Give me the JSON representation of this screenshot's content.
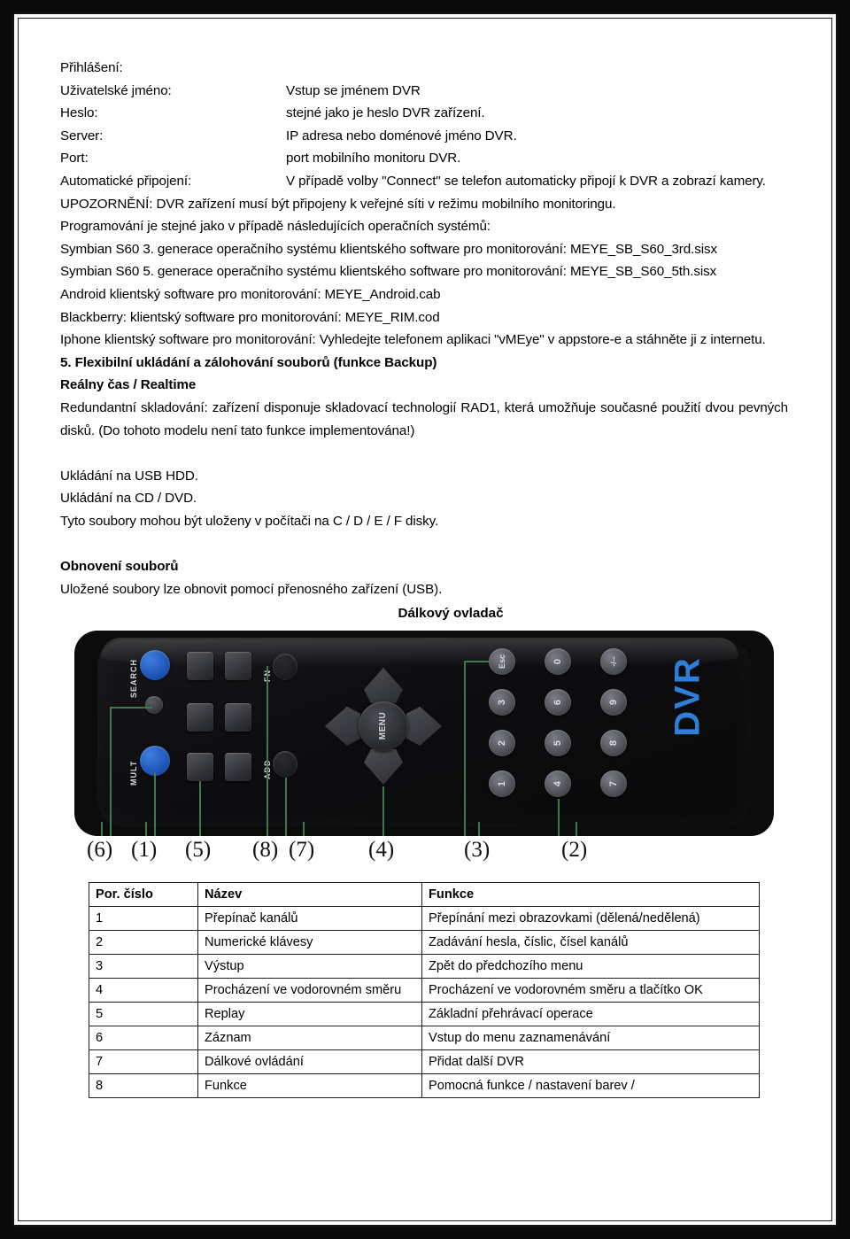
{
  "document": {
    "login_section": {
      "title": "Přihlášení:",
      "fields": [
        {
          "label": "Uživatelské jméno:",
          "value": "Vstup se jménem DVR"
        },
        {
          "label": "Heslo:",
          "value": "stejné jako je heslo DVR zařízení."
        },
        {
          "label": "Server:",
          "value": "IP adresa nebo doménové jméno DVR."
        },
        {
          "label": "Port:",
          "value": "port mobilního monitoru DVR."
        },
        {
          "label": "Automatické připojení:",
          "value": "V případě volby \"Connect\" se telefon automaticky připojí k DVR a zobrazí kamery."
        }
      ]
    },
    "notice": "UPOZORNĚNÍ: DVR zařízení musí být připojeny k veřejné síti v režimu mobilního monitoringu.",
    "programming_intro": "Programování je stejné jako v případě následujících operačních systémů:",
    "platforms": [
      "Symbian S60 3. generace operačního systému klientského software pro monitorování: MEYE_SB_S60_3rd.sisx",
      "Symbian S60 5. generace operačního systému klientského software pro monitorování: MEYE_SB_S60_5th.sisx",
      "Android klientský software pro monitorování: MEYE_Android.cab",
      "Blackberry: klientský software pro monitorování: MEYE_RIM.cod",
      "Iphone klientský software pro monitorování: Vyhledejte telefonem aplikaci \"vMEye\" v appstore-e a stáhněte ji z internetu."
    ],
    "section5": {
      "heading": "5. Flexibilní ukládání a zálohování souborů (funkce Backup)",
      "subheading": "Reálny čas / Realtime",
      "body": "Redundantní skladování: zařízení disponuje skladovací technologií RAD1, která umožňuje současné použití dvou pevných disků. (Do tohoto modelu není tato funkce implementována!)",
      "storage_lines": [
        "Ukládání na USB HDD.",
        "Ukládání na CD / DVD.",
        "Tyto soubory mohou být uloženy v počítači na C / D / E / F disky."
      ]
    },
    "restore": {
      "heading": "Obnovení souborů",
      "body": "Uložené soubory lze obnovit pomocí přenosného zařízení (USB)."
    },
    "figure": {
      "caption": "Dálkový ovladač",
      "labels": {
        "search": "SEARCH",
        "mult": "MULT",
        "fn": "FN",
        "add": "ADD",
        "menu": "MENU",
        "esc": "Esc",
        "brand": "DVR"
      },
      "keypad_keys": [
        "Esc",
        "0",
        "-/--",
        "3",
        "6",
        "9",
        "2",
        "5",
        "8",
        "1",
        "4",
        "7"
      ],
      "callouts": [
        "(6)",
        "(1)",
        "(5)",
        "(8)",
        "(7)",
        "(4)",
        "(3)",
        "(2)"
      ]
    },
    "table": {
      "headers": [
        "Por. číslo",
        "Název",
        "Funkce"
      ],
      "rows": [
        {
          "num": "1",
          "name": "Přepínač kanálů",
          "func": "Přepínání mezi obrazovkami (dělená/nedělená)"
        },
        {
          "num": "2",
          "name": "Numerické klávesy",
          "func": "Zadávání hesla, číslic, čísel kanálů"
        },
        {
          "num": "3",
          "name": "Výstup",
          "func": "Zpět do předchozího menu"
        },
        {
          "num": "4",
          "name": "Procházení ve vodorovném směru",
          "func": "Procházení ve vodorovném směru a tlačítko OK"
        },
        {
          "num": "5",
          "name": "Replay",
          "func": "Základní přehrávací operace"
        },
        {
          "num": "6",
          "name": "Záznam",
          "func": "Vstup do menu zaznamenávání"
        },
        {
          "num": "7",
          "name": "Dálkové ovládání",
          "func": "Přidat další DVR"
        },
        {
          "num": "8",
          "name": "Funkce",
          "func": "Pomocná funkce / nastavení barev /"
        }
      ]
    }
  }
}
